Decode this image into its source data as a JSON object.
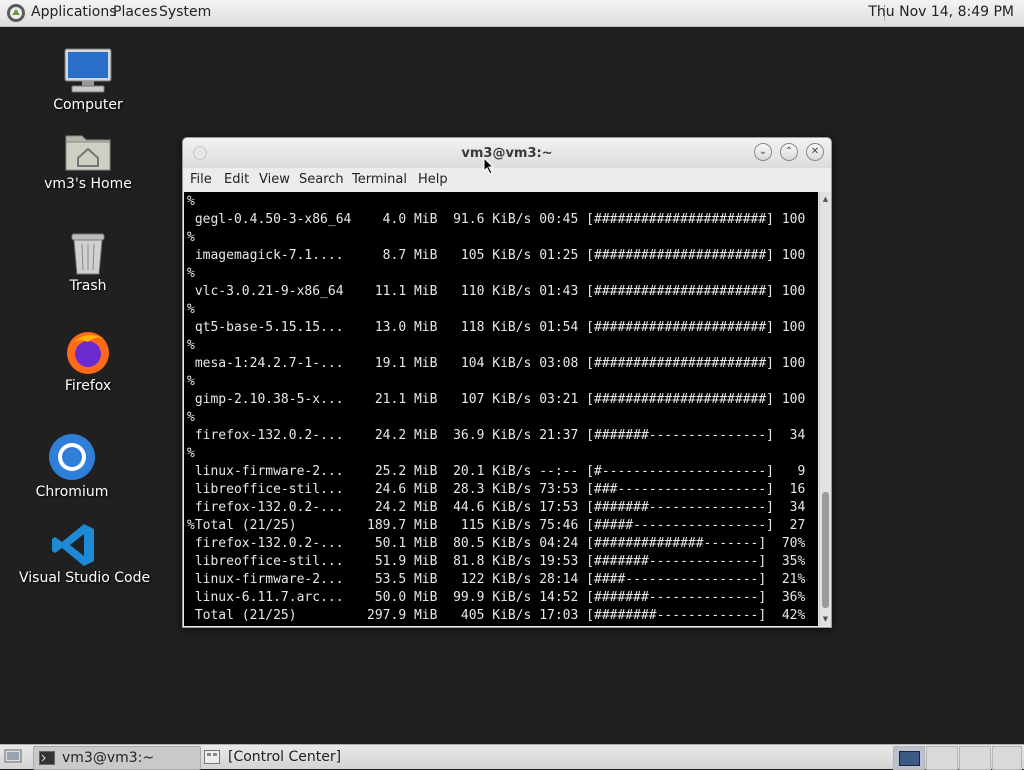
{
  "top_panel": {
    "menus": [
      "Applications",
      "Places",
      "System"
    ],
    "clock": "Thu Nov 14,  8:49 PM"
  },
  "desktop": {
    "icons": [
      {
        "label": "Computer",
        "icon": "computer-icon"
      },
      {
        "label": "vm3's Home",
        "icon": "home-folder-icon"
      },
      {
        "label": "Trash",
        "icon": "trash-icon"
      },
      {
        "label": "Firefox",
        "icon": "firefox-icon"
      },
      {
        "label": "Chromium",
        "icon": "chromium-icon"
      },
      {
        "label": "Visual Studio Code",
        "icon": "vscode-icon"
      }
    ]
  },
  "terminal": {
    "title": "vm3@vm3:~",
    "menu": [
      "File",
      "Edit",
      "View",
      "Search",
      "Terminal",
      "Help"
    ],
    "lines": [
      "%",
      " gegl-0.4.50-3-x86_64    4.0 MiB  91.6 KiB/s 00:45 [######################] 100",
      "%",
      " imagemagick-7.1....     8.7 MiB   105 KiB/s 01:25 [######################] 100",
      "%",
      " vlc-3.0.21-9-x86_64    11.1 MiB   110 KiB/s 01:43 [######################] 100",
      "%",
      " qt5-base-5.15.15...    13.0 MiB   118 KiB/s 01:54 [######################] 100",
      "%",
      " mesa-1:24.2.7-1-...    19.1 MiB   104 KiB/s 03:08 [######################] 100",
      "%",
      " gimp-2.10.38-5-x...    21.1 MiB   107 KiB/s 03:21 [######################] 100",
      "%",
      " firefox-132.0.2-...    24.2 MiB  36.9 KiB/s 21:37 [#######---------------]  34",
      "%",
      " linux-firmware-2...    25.2 MiB  20.1 KiB/s --:-- [#---------------------]   9",
      " libreoffice-stil...    24.6 MiB  28.3 KiB/s 73:53 [###-------------------]  16",
      " firefox-132.0.2-...    24.2 MiB  44.6 KiB/s 17:53 [#######---------------]  34",
      "%Total (21/25)         189.7 MiB   115 KiB/s 75:46 [#####-----------------]  27",
      " firefox-132.0.2-...    50.1 MiB  80.5 KiB/s 04:24 [##############-------]  70%",
      " libreoffice-stil...    51.9 MiB  81.8 KiB/s 19:53 [#######--------------]  35%",
      " linux-firmware-2...    53.5 MiB   122 KiB/s 28:14 [####-----------------]  21%",
      " linux-6.11.7.arc...    50.0 MiB  99.9 KiB/s 14:52 [#######--------------]  36%",
      " Total (21/25)         297.9 MiB   405 KiB/s 17:03 [########-------------]  42%"
    ]
  },
  "bottom_panel": {
    "tasks": [
      {
        "label": "vm3@vm3:~",
        "icon": "terminal-icon"
      },
      {
        "label": "[Control Center]",
        "icon": "control-center-icon"
      }
    ]
  }
}
